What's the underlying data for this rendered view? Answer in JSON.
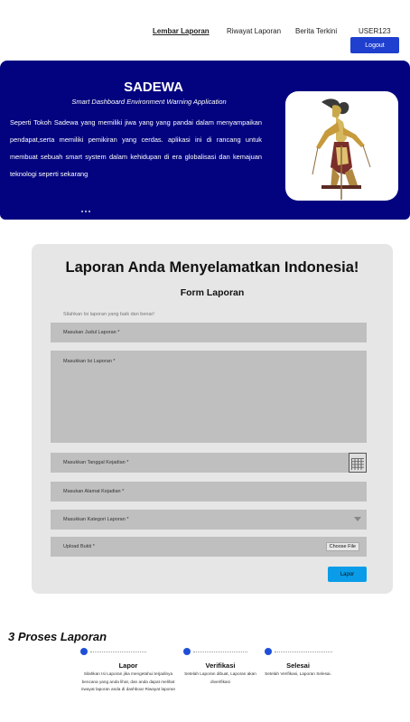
{
  "nav": {
    "items": [
      {
        "label": "Lembar Laporan",
        "active": true
      },
      {
        "label": "Riwayat Laporan",
        "active": false
      },
      {
        "label": "Berita Terkini",
        "active": false
      },
      {
        "label": "USER123",
        "active": false
      }
    ],
    "logout_label": "Logout"
  },
  "hero": {
    "title": "SADEWA",
    "subtitle": "Smart Dashboard Environment Warning Application",
    "description": "Seperti Tokoh Sadewa yang memiliki jiwa yang yang pandai dalam menyampaikan pendapat,serta memiliki pemikiran yang cerdas. aplikasi ini di rancang untuk membuat sebuah smart system dalam kehidupan di era globalisasi dan kemajuan teknologi seperti sekarang",
    "image_icon": "wayang-puppet-image"
  },
  "form": {
    "heading": "Laporan Anda Menyelamatkan Indonesia!",
    "title": "Form Laporan",
    "hint": "Silahkan Isi laporan yang baik dan benar!",
    "fields": {
      "judul": "Masukan Judul Laporan *",
      "isi": "Masukkan Isi Laporan *",
      "tanggal": "Masukkan Tanggal Kejadian *",
      "alamat": "Masukan Alamat Kejadian *",
      "kategori": "Masukkan Kategori Laporan *",
      "bukti": "Upload Bukti *"
    },
    "choose_file_label": "Choose File",
    "submit_label": "Lapor"
  },
  "process": {
    "title": "3 Proses Laporan",
    "steps": [
      {
        "label": "Lapor",
        "desc": "Silahkan Isi Laporan jika mengetahui terjadinya bencana yang anda lihat, dan anda dapat melihat riwayat laporan anda di dashboar Riwayat laporan"
      },
      {
        "label": "Verifikasi",
        "desc": "Setelah Laporan dibuat, Laporan akan diverifikasi"
      },
      {
        "label": "Selesai",
        "desc": "Setelah Verifikasi, Laporan Selesai."
      }
    ]
  },
  "colors": {
    "hero_bg": "#03037f",
    "logout_bg": "#1f3fcf",
    "submit_bg": "#0a9ce8",
    "step_dot": "#1f4fd8"
  }
}
